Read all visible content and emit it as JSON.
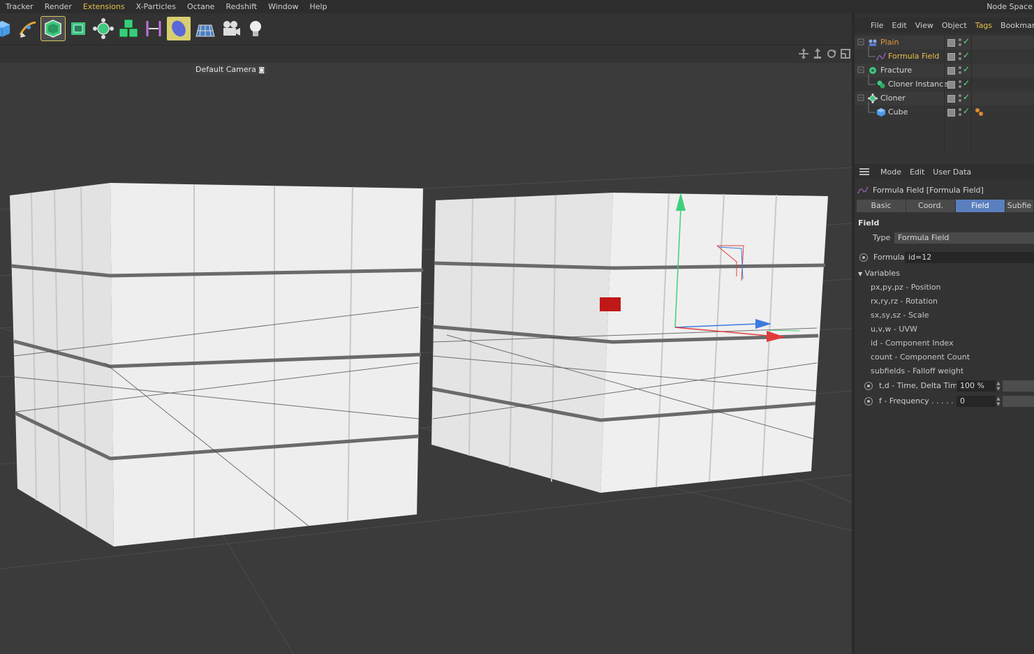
{
  "menubar": {
    "items": [
      {
        "label": "Tracker",
        "highlight": false
      },
      {
        "label": "Render",
        "highlight": false
      },
      {
        "label": "Extensions",
        "highlight": true
      },
      {
        "label": "X-Particles",
        "highlight": false
      },
      {
        "label": "Octane",
        "highlight": false
      },
      {
        "label": "Redshift",
        "highlight": false
      },
      {
        "label": "Window",
        "highlight": false
      },
      {
        "label": "Help",
        "highlight": false
      }
    ],
    "right_label": "Node Space"
  },
  "toolbar": {
    "tools": [
      "cube-icon",
      "pen-icon",
      "generator-icon",
      "subdivision-icon",
      "cloner-icon",
      "array-icon",
      "bend-icon",
      "field-icon",
      "floor-icon",
      "camera-icon",
      "light-icon"
    ]
  },
  "viewport": {
    "camera_label": "Default Camera"
  },
  "object_manager": {
    "menu": [
      {
        "label": "File",
        "highlight": false
      },
      {
        "label": "Edit",
        "highlight": false
      },
      {
        "label": "View",
        "highlight": false
      },
      {
        "label": "Object",
        "highlight": false
      },
      {
        "label": "Tags",
        "highlight": true
      },
      {
        "label": "Bookmar",
        "highlight": false
      }
    ],
    "objects": [
      {
        "name": "Plain",
        "style": "orange",
        "icon": "plain-effector-icon"
      },
      {
        "name": "Formula Field",
        "style": "yellow",
        "icon": "formula-field-icon"
      },
      {
        "name": "Fracture",
        "style": "normal",
        "icon": "fracture-icon"
      },
      {
        "name": "Cloner Instance",
        "style": "normal",
        "icon": "cloner-instance-icon"
      },
      {
        "name": "Cloner",
        "style": "normal",
        "icon": "cloner-icon"
      },
      {
        "name": "Cube",
        "style": "normal",
        "icon": "cube-icon"
      }
    ]
  },
  "attribute_manager": {
    "menu": [
      {
        "label": "Mode"
      },
      {
        "label": "Edit"
      },
      {
        "label": "User Data"
      }
    ],
    "title": "Formula Field [Formula Field]",
    "tabs": [
      {
        "label": "Basic",
        "active": false
      },
      {
        "label": "Coord.",
        "active": false
      },
      {
        "label": "Field",
        "active": true
      },
      {
        "label": "Subfie",
        "active": false
      }
    ],
    "section": "Field",
    "type_label": "Type",
    "type_value": "Formula Field",
    "formula_label": "Formula",
    "formula_value": "id=12",
    "variables_label": "Variables",
    "variables": [
      "px,py,pz - Position",
      "rx,ry,rz - Rotation",
      "sx,sy,sz - Scale",
      "u,v,w - UVW",
      "id - Component Index",
      "count - Component Count",
      "subfields - Falloff weight"
    ],
    "time_label": "t,d - Time, Delta Time",
    "time_value": "100 %",
    "freq_label": "f - Frequency . . . . . .",
    "freq_value": "0"
  }
}
